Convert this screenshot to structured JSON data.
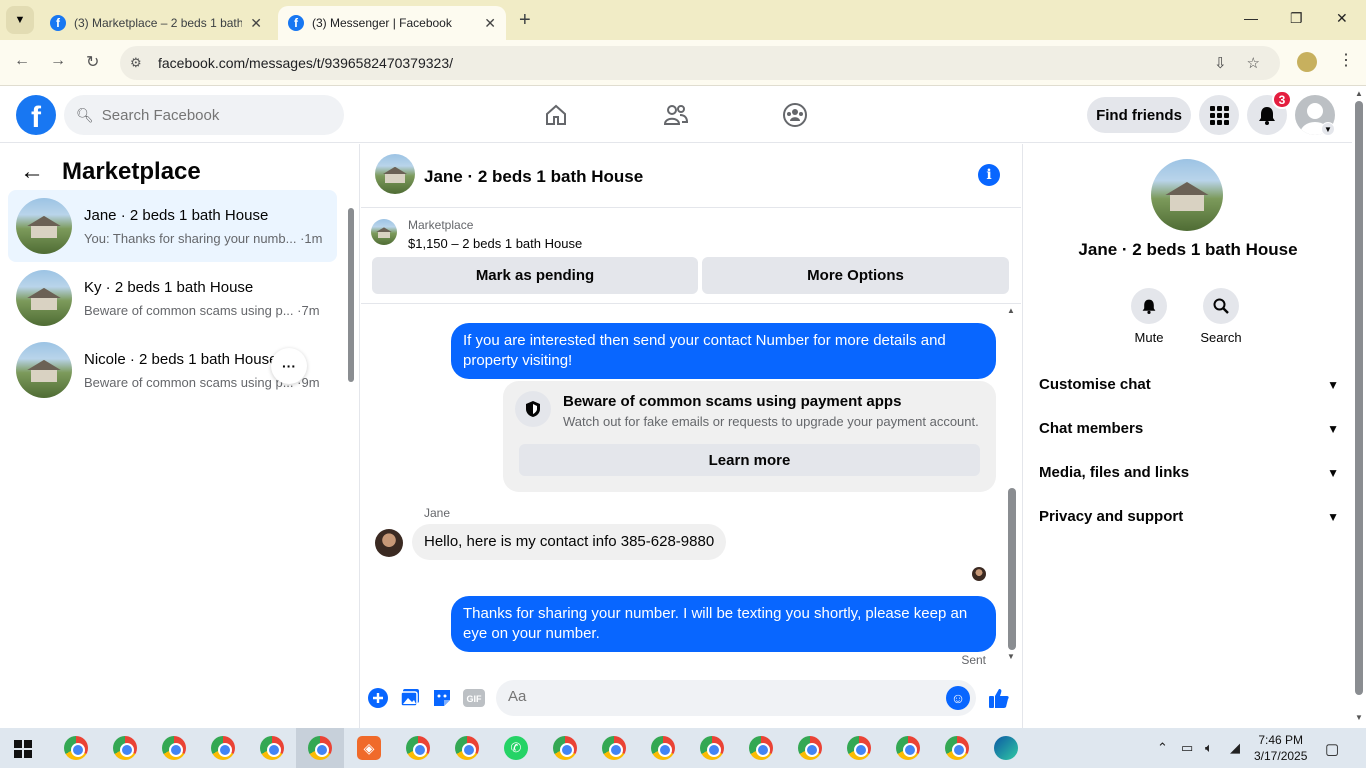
{
  "browser": {
    "tabs": [
      {
        "title": "(3) Marketplace – 2 beds 1 bath"
      },
      {
        "title": "(3) Messenger | Facebook"
      }
    ],
    "url": "facebook.com/messages/t/9396582470379323/"
  },
  "header": {
    "search_placeholder": "Search Facebook",
    "find_friends": "Find friends",
    "notifications_count": "3"
  },
  "sidebar": {
    "title": "Marketplace",
    "conversations": [
      {
        "name": "Jane · 2 beds 1 bath House",
        "preview": "You: Thanks for sharing your numb... ·1m",
        "active": true
      },
      {
        "name": "Ky · 2 beds 1 bath House",
        "preview": "Beware of common scams using p... ·7m"
      },
      {
        "name": "Nicole · 2 beds 1 bath House",
        "preview": "Beware of common scams using p... ·9m"
      }
    ]
  },
  "chat": {
    "title": "Jane · 2 beds 1 bath House",
    "listing_label": "Marketplace",
    "listing_price": "$1,150 – 2 beds 1 bath House",
    "mark_pending": "Mark as pending",
    "more_options": "More Options",
    "messages": {
      "out1": "If you are interested then send your contact Number  for more details and property visiting!",
      "scam_title": "Beware of common scams using payment apps",
      "scam_desc": "Watch out for fake emails or requests to upgrade your payment account.",
      "learn_more": "Learn more",
      "sender": "Jane",
      "in1": "Hello, here is my contact info 385-628-9880",
      "out2": "Thanks for sharing your number. I will be texting you shortly, please keep an eye on your number.",
      "status": "Sent"
    },
    "composer_placeholder": "Aa"
  },
  "info_panel": {
    "name": "Jane · 2 beds 1 bath House",
    "actions": [
      "Mute",
      "Search"
    ],
    "sections": [
      "Customise chat",
      "Chat members",
      "Media, files and links",
      "Privacy and support"
    ]
  },
  "taskbar": {
    "time": "7:46 PM",
    "date": "3/17/2025"
  },
  "colors": {
    "brand": "#1877f2",
    "bubble_out": "#0866ff",
    "active_conversation": "#ebf5ff",
    "badge": "#e41e3f"
  }
}
